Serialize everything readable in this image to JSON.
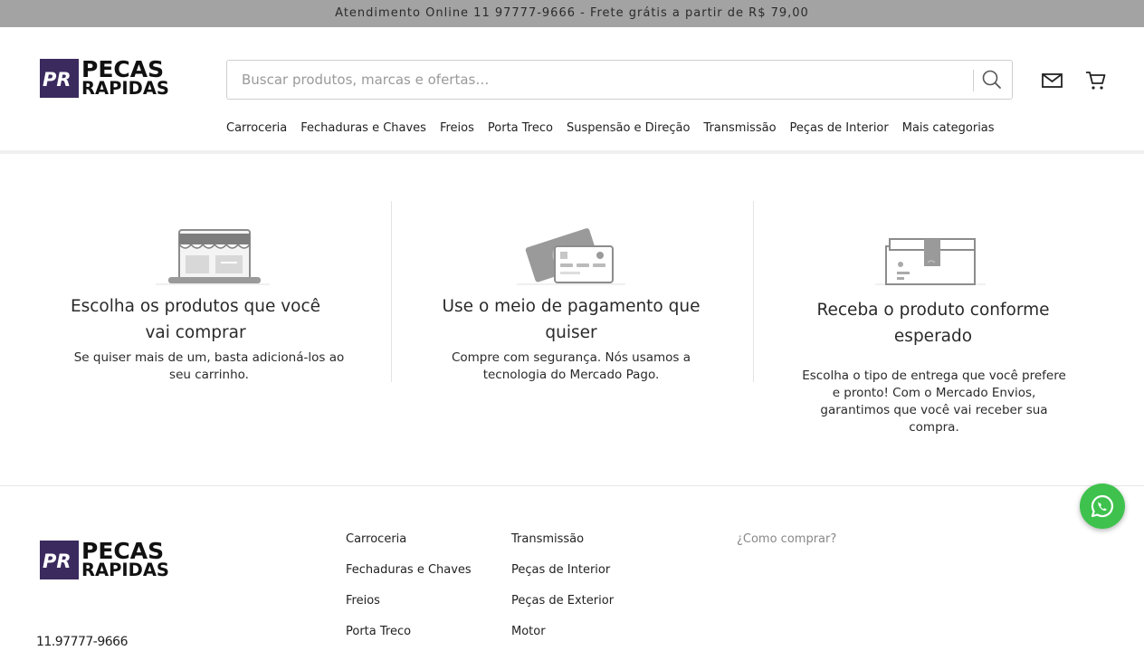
{
  "topbar": {
    "text": "Atendimento Online 11 97777-9666 - Frete grátis a partir de R$ 79,00"
  },
  "brand": {
    "line1": "PECAS",
    "line2": "RAPIDAS",
    "mark_color": "#3b2a5e"
  },
  "search": {
    "placeholder": "Buscar produtos, marcas e ofertas…",
    "value": "",
    "icon": "search-icon"
  },
  "header_icons": [
    "mail-icon",
    "cart-icon"
  ],
  "nav": {
    "items": [
      "Carroceria",
      "Fechaduras e Chaves",
      "Freios",
      "Porta Treco",
      "Suspensão e Direção",
      "Transmissão",
      "Peças de Interior",
      "Mais categorias"
    ]
  },
  "steps": [
    {
      "icon": "storefront-laptop-icon",
      "title": "Escolha os produtos que você vai comprar",
      "text": "Se quiser mais de um, basta adicioná-los ao seu carrinho."
    },
    {
      "icon": "payment-cards-icon",
      "title": "Use o meio de pagamento que quiser",
      "text": "Compre com segurança. Nós usamos a tecnologia do Mercado Pago."
    },
    {
      "icon": "shipping-box-icon",
      "title": "Receba o produto conforme esperado",
      "text": "Escolha o tipo de entrega que você prefere e pronto! Com o Mercado Envios, garantimos que você vai receber sua compra."
    }
  ],
  "footer": {
    "col1": [
      "Carroceria",
      "Fechaduras e Chaves",
      "Freios",
      "Porta Treco"
    ],
    "col2": [
      "Transmissão",
      "Peças de Interior",
      "Peças de Exterior",
      "Motor"
    ],
    "help": "¿Como comprar?",
    "phone": "11.97777-9666"
  },
  "colors": {
    "whatsapp": "#3ec24d",
    "topbar": "#a3a3a3"
  }
}
